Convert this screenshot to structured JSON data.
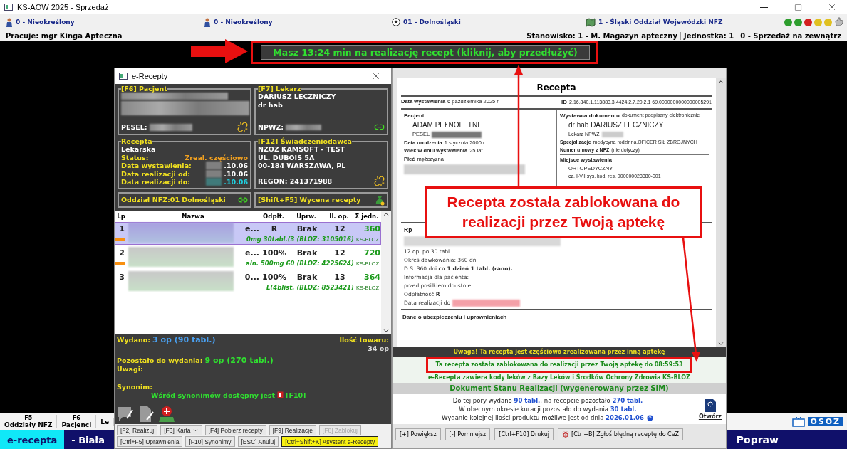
{
  "window": {
    "title": "KS-AOW 2025 - Sprzedaż"
  },
  "info_bar": {
    "items": [
      {
        "label": "0 - Nieokreślony",
        "kind": "person"
      },
      {
        "label": "0 - Nieokreślony",
        "kind": "person"
      },
      {
        "label": "01 - Dolnośląski",
        "kind": "ball"
      },
      {
        "label": "1 - Śląski Oddział Wojewódzki NFZ",
        "kind": "map"
      }
    ],
    "status_lights": [
      {
        "color": "#2e9e2e"
      },
      {
        "color": "#2e9e2e"
      },
      {
        "color": "#d42020"
      },
      {
        "color": "#e0c020"
      },
      {
        "color": "#e0c020"
      }
    ]
  },
  "user_bar": {
    "user": "Pracuje: mgr Kinga Apteczna",
    "station": "Stanowisko: 1 - M. Magazyn apteczny",
    "unit": "Jednostka: 1",
    "sale": "0 - Sprzedaż na zewnątrz"
  },
  "timer": "Masz 13:24 min na realizację recept (kliknij, aby przedłużyć)",
  "erecepty": {
    "title": "e-Recepty",
    "patient": {
      "legend": "[F6] Pacjent",
      "pesel_label": "PESEL:"
    },
    "doctor": {
      "legend": "[F7] Lekarz",
      "name": "DARIUSZ LECZNICZY",
      "title": "dr hab",
      "npwz_label": "NPWZ:"
    },
    "prescription": {
      "legend": "Recepta",
      "type": "Lekarska",
      "fields": [
        {
          "label": "Status:",
          "value": "Zreal. częściowo",
          "color": "#f0a020"
        },
        {
          "label": "Data wystawienia:",
          "value": ".10.06",
          "color": "#ffffff"
        },
        {
          "label": "Data realizacji od:",
          "value": ".10.06",
          "color": "#ffffff"
        },
        {
          "label": "Data realizacji do:",
          "value": ".10.06",
          "color": "#20d0e0"
        }
      ]
    },
    "provider": {
      "legend": "[F12] Świadczeniodawca",
      "lines": [
        "NZOZ KAMSOFT - TEST",
        "UL. DUBOIS 5A",
        "00-184 WARSZAWA, PL"
      ],
      "regon": "REGON: 241371988"
    },
    "nfz": "Oddział NFZ:01 Dolnośląski",
    "pricing": "[Shift+F5] Wycena recepty",
    "table": {
      "columns": [
        "Lp",
        "Nazwa",
        "Odpłt.",
        "Uprw.",
        "Il. op.",
        "Σ jedn."
      ],
      "rows": [
        {
          "lp": "1",
          "name": "e...",
          "detail": "0mg 30tabl.(3 (BLOZ: 3105016)",
          "payment": "R",
          "entitlement": "Brak",
          "packs": "12",
          "units": "360",
          "tag": "KS-BLOZ",
          "selected": true,
          "marked": true
        },
        {
          "lp": "2",
          "name": "e...",
          "detail": "aln. 500mg 60 (BLOZ: 4225624)",
          "payment": "100%",
          "entitlement": "Brak",
          "packs": "12",
          "units": "720",
          "tag": "KS-BLOZ",
          "selected": false,
          "marked": true
        },
        {
          "lp": "3",
          "name": "0...",
          "detail": "L(4blist. (BLOZ: 8523421)",
          "payment": "100%",
          "entitlement": "Brak",
          "packs": "13",
          "units": "364",
          "tag": "KS-BLOZ",
          "selected": false,
          "marked": false
        }
      ]
    },
    "summary": {
      "issued_label": "Wydano:",
      "issued": "3 op (90 tabl.)",
      "stock_label": "Ilość towaru:",
      "stock": "34 op",
      "remaining_label": "Pozostało do wydania:",
      "remaining": "9 op (270 tabl.)",
      "notes_label": "Uwagi:",
      "synonym_label": "Synonim:",
      "synonym_text": "Wśród synonimów dostępny jest",
      "synonym_key": "[F10]"
    },
    "buttons": [
      [
        {
          "label": "[F2] Realizuj",
          "kind": "plain"
        },
        {
          "label": "[F3] Karta",
          "kind": "menu"
        },
        {
          "label": "[F4] Pobierz recepty",
          "kind": "plain"
        },
        {
          "label": "[F9] Realizacje",
          "kind": "plain"
        },
        {
          "label": "[F8] Zablokuj",
          "kind": "disabled"
        }
      ],
      [
        {
          "label": "[Ctrl+F5] Uprawnienia",
          "kind": "plain"
        },
        {
          "label": "[F10] Synonimy",
          "kind": "plain"
        },
        {
          "label": "[ESC] Anuluj",
          "kind": "plain"
        },
        {
          "label": "[Ctrl+Shift+K] Asystent e-Recepty",
          "kind": "highlight"
        }
      ]
    ]
  },
  "document": {
    "heading": "Recepta",
    "issue_label": "Data wystawienia",
    "issue_date": "6 października 2025 r.",
    "id_label": "ID",
    "id": "2.16.840.1.113883.3.4424.2.7.20.2.1 69.0000000000000005291",
    "patient": {
      "heading": "Pacjent",
      "name": "ADAM PEŁNOLETNI",
      "pesel_label": "PESEL",
      "fields": [
        {
          "label": "Data urodzenia",
          "value": "1 stycznia 2000 r."
        },
        {
          "label": "Wiek w dniu wystawienia",
          "value": "25 lat"
        },
        {
          "label": "Płeć",
          "value": "mężczyzna"
        }
      ]
    },
    "issuer": {
      "heading": "Wystawca dokumentu",
      "note": "dokument podpisany elektronicznie",
      "name": "dr hab DARIUSZ LECZNICZY",
      "npwz_label": "Lekarz NPWZ",
      "fields": [
        {
          "label": "Specjalizacje",
          "value": "medycyna rodzinna,OFICER SIŁ ZBROJNYCH"
        },
        {
          "label": "Numer umowy z NFZ",
          "value": "(nie dotyczy)"
        }
      ],
      "place_heading": "Miejsce wystawienia",
      "place": "ORTOPEDYCZNY",
      "place_code": "cz. I-VII sys. kod. res. 000000023380-001"
    },
    "rp": {
      "heading": "Rp",
      "lines": [
        "12 op. po 30 tabl.",
        "Okres dawkowania: 360 dni",
        "D.S. 360 dni **co 1 dzień 1 tabl. (rano).**",
        "Informacja dla pacjenta:",
        "przed posiłkiem doustnie",
        "Odpłatność **R**"
      ],
      "due_label": "Data realizacji do"
    },
    "insurance_heading": "Dane o ubezpieczeniu i uprawnieniach",
    "warning": "Uwaga! Ta recepta jest częściowo zrealizowana przez inną aptekę",
    "locked": "Ta recepta została zablokowana do realizacji przez Twoją aptekę do 08:59:53",
    "ksbloz": "e-Recepta zawiera kody leków z Bazy Leków i Środków Ochrony Zdrowia KS-BLOZ",
    "dsr_heading": "Dokument Stanu Realizacji (wygenerowany przez SIM)",
    "dsr_lines": [
      "Do tej pory wydano **90 tabl.**, na recepcie pozostało **270 tabl.**",
      "W obecnym okresie kuracji pozostało do wydania **30 tabl.**",
      "Wydanie kolejnej ilości produktu możliwe jest od dnia **2026.01.06**"
    ],
    "dsr_open": "Otwórz",
    "buttons": [
      "[+] Powiększ",
      "[-] Pomniejsz",
      "[Ctrl+F10] Drukuj",
      "[Ctrl+B] Zgłoś błędną receptę do CeZ"
    ]
  },
  "fkeys": [
    {
      "key": "F5",
      "label": "Oddziały NFZ"
    },
    {
      "key": "F6",
      "label": "Pacjenci"
    },
    {
      "label": "Le"
    }
  ],
  "logo": "OSOZ",
  "bottom_tabs": [
    {
      "label": "e-recepta",
      "selected": true
    },
    {
      "label": "- Biała",
      "selected": false
    }
  ],
  "bottom_action": "Popraw",
  "annotation": "Recepta została zablokowana do realizacji przez Twoją aptekę"
}
